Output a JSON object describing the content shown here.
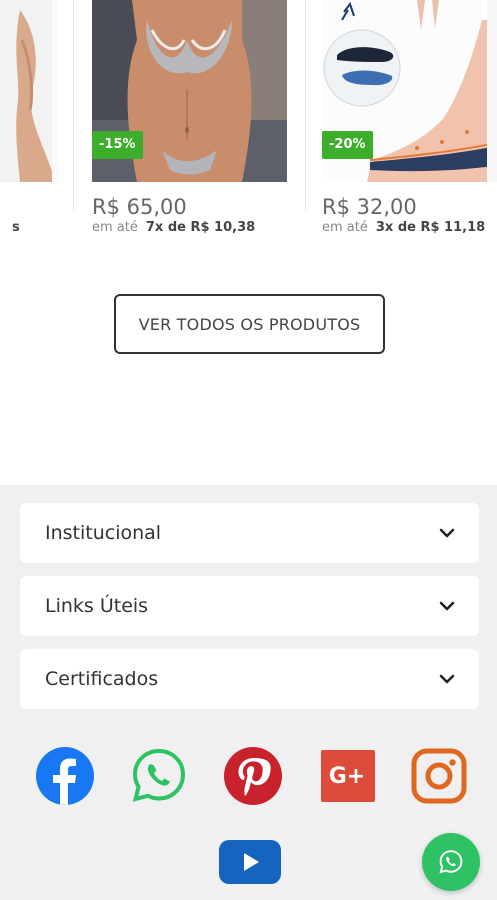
{
  "products": [
    {
      "price": "",
      "installment_prefix": "",
      "installment_value": "s",
      "badge": ""
    },
    {
      "price": "R$ 65,00",
      "installment_prefix": "em até",
      "installment_value": "7x de R$ 10,38",
      "badge": "-15%"
    },
    {
      "price": "R$ 32,00",
      "installment_prefix": "em até",
      "installment_value": "3x de R$ 11,18",
      "badge": "-20%"
    }
  ],
  "view_all_button": "VER TODOS OS PRODUTOS",
  "footer": {
    "sections": [
      {
        "label": "Institucional"
      },
      {
        "label": "Links Úteis"
      },
      {
        "label": "Certificados"
      }
    ],
    "social_icons": [
      "facebook-icon",
      "whatsapp-icon",
      "pinterest-icon",
      "google-plus-icon",
      "instagram-icon",
      "youtube-icon"
    ]
  },
  "floating_button_icon": "whatsapp-icon",
  "colors": {
    "discount_badge": "#3dae2b",
    "facebook": "#1877f2",
    "whatsapp": "#2ec264",
    "pinterest": "#c8232c",
    "google_plus": "#dd4b39",
    "instagram": "#e1661f",
    "youtube": "#1565c0",
    "footer_bg": "#f0f0f0"
  }
}
